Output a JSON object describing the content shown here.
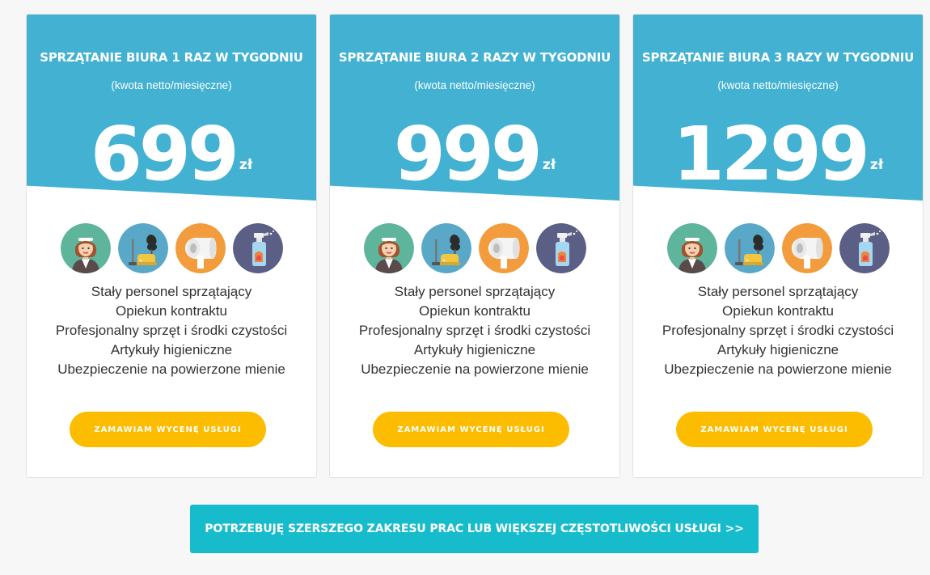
{
  "colors": {
    "card_header": "#43b1d1",
    "order_button": "#fcbc00",
    "wide_button": "#17bccc",
    "text_dark": "#333333",
    "background": "#f7f7f7"
  },
  "icons": [
    "maid-icon",
    "vacuum-cleaner-icon",
    "toilet-paper-icon",
    "spray-bottle-icon"
  ],
  "cards": [
    {
      "title": "SPRZĄTANIE BIURA 1 RAZ W TYGODNIU",
      "subtitle": "(kwota netto/miesięczne)",
      "price": "699",
      "currency": "zł",
      "features": [
        "Stały personel sprzątający",
        "Opiekun kontraktu",
        "Profesjonalny sprzęt i środki czystości",
        "Artykuły higieniczne",
        "Ubezpieczenie na powierzone mienie"
      ],
      "button_label": "ZAMAWIAM WYCENĘ USŁUGI"
    },
    {
      "title": "SPRZĄTANIE BIURA 2 RAZY W TYGODNIU",
      "subtitle": "(kwota netto/miesięczne)",
      "price": "999",
      "currency": "zł",
      "features": [
        "Stały personel sprzątający",
        "Opiekun kontraktu",
        "Profesjonalny sprzęt i środki czystości",
        "Artykuły higieniczne",
        "Ubezpieczenie na powierzone mienie"
      ],
      "button_label": "ZAMAWIAM WYCENĘ USŁUGI"
    },
    {
      "title": "SPRZĄTANIE BIURA 3 RAZY W TYGODNIU",
      "subtitle": "(kwota netto/miesięczne)",
      "price": "1299",
      "currency": "zł",
      "features": [
        "Stały personel sprzątający",
        "Opiekun kontraktu",
        "Profesjonalny sprzęt i środki czystości",
        "Artykuły higieniczne",
        "Ubezpieczenie na powierzone mienie"
      ],
      "button_label": "ZAMAWIAM WYCENĘ USŁUGI"
    }
  ],
  "wide_button_label": "POTRZEBUJĘ SZERSZEGO ZAKRESU PRAC LUB WIĘKSZEJ CZĘSTOTLIWOŚCI USŁUGI >>"
}
